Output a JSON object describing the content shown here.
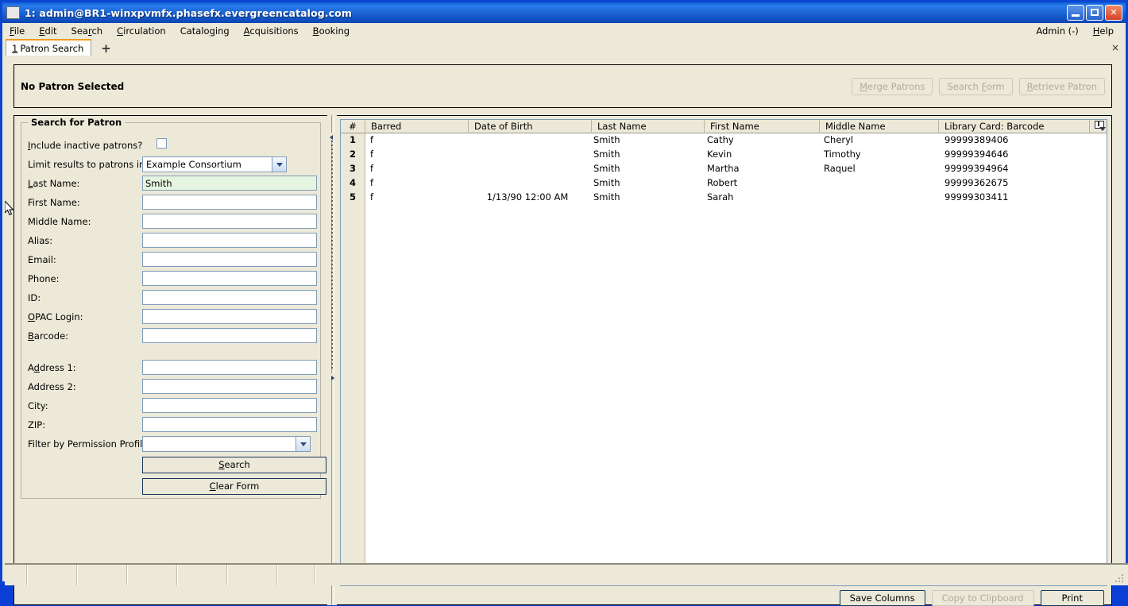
{
  "window": {
    "title": "1: admin@BR1-winxpvmfx.phasefx.evergreencatalog.com",
    "minimize_label": "Minimize",
    "maximize_label": "Maximize",
    "close_label": "Close"
  },
  "menubar": {
    "items": [
      {
        "label": "File",
        "accel": "F"
      },
      {
        "label": "Edit",
        "accel": "E"
      },
      {
        "label": "Search",
        "accel": "r"
      },
      {
        "label": "Circulation",
        "accel": "C"
      },
      {
        "label": "Cataloging",
        "accel": "g"
      },
      {
        "label": "Acquisitions",
        "accel": "A"
      },
      {
        "label": "Booking",
        "accel": "B"
      }
    ],
    "right": [
      {
        "label": "Admin (-)",
        "accel": ""
      },
      {
        "label": "Help",
        "accel": "H"
      }
    ]
  },
  "tabs": {
    "active": {
      "number": "1",
      "label": "Patron Search"
    },
    "add_label": "+",
    "close_label": "×"
  },
  "patron_band": {
    "title": "No Patron Selected",
    "buttons": [
      {
        "label": "Merge Patrons",
        "disabled": true
      },
      {
        "label": "Search Form",
        "disabled": true
      },
      {
        "label": "Retrieve Patron",
        "disabled": true
      }
    ]
  },
  "search_form": {
    "legend": "Search for Patron",
    "fields": [
      {
        "name": "include-inactive",
        "label": "Include inactive patrons?",
        "type": "checkbox",
        "value": "",
        "checked": false
      },
      {
        "name": "limit-results-org",
        "label": "Limit results to patrons in",
        "type": "select",
        "value": "Example Consortium"
      },
      {
        "name": "last-name",
        "label": "Last Name:",
        "type": "text",
        "value": "Smith",
        "focused": true
      },
      {
        "name": "first-name",
        "label": "First Name:",
        "type": "text",
        "value": ""
      },
      {
        "name": "middle-name",
        "label": "Middle Name:",
        "type": "text",
        "value": ""
      },
      {
        "name": "alias",
        "label": "Alias:",
        "type": "text",
        "value": ""
      },
      {
        "name": "email",
        "label": "Email:",
        "type": "text",
        "value": ""
      },
      {
        "name": "phone",
        "label": "Phone:",
        "type": "text",
        "value": ""
      },
      {
        "name": "id",
        "label": "ID:",
        "type": "text",
        "value": ""
      },
      {
        "name": "opac-login",
        "label": "OPAC Login:",
        "type": "text",
        "value": ""
      },
      {
        "name": "barcode",
        "label": "Barcode:",
        "type": "text",
        "value": ""
      },
      {
        "name": "address-1",
        "label": "Address 1:",
        "type": "text",
        "value": ""
      },
      {
        "name": "address-2",
        "label": "Address 2:",
        "type": "text",
        "value": ""
      },
      {
        "name": "city",
        "label": "City:",
        "type": "text",
        "value": ""
      },
      {
        "name": "zip",
        "label": "ZIP:",
        "type": "text",
        "value": ""
      },
      {
        "name": "permission-profile",
        "label": "Filter by Permission Profile:",
        "type": "select",
        "value": ""
      }
    ],
    "search_button": "Search",
    "clear_button": "Clear Form"
  },
  "results": {
    "columns": [
      {
        "key": "num",
        "label": "#"
      },
      {
        "key": "barred",
        "label": "Barred"
      },
      {
        "key": "dob",
        "label": "Date of Birth"
      },
      {
        "key": "last",
        "label": "Last Name"
      },
      {
        "key": "first",
        "label": "First Name"
      },
      {
        "key": "middle",
        "label": "Middle Name"
      },
      {
        "key": "barcode",
        "label": "Library Card: Barcode"
      }
    ],
    "rows": [
      {
        "num": "1",
        "barred": "f",
        "dob": "",
        "last": "Smith",
        "first": "Cathy",
        "middle": "Cheryl",
        "barcode": "99999389406"
      },
      {
        "num": "2",
        "barred": "f",
        "dob": "",
        "last": "Smith",
        "first": "Kevin",
        "middle": "Timothy",
        "barcode": "99999394646"
      },
      {
        "num": "3",
        "barred": "f",
        "dob": "",
        "last": "Smith",
        "first": "Martha",
        "middle": "Raquel",
        "barcode": "99999394964"
      },
      {
        "num": "4",
        "barred": "f",
        "dob": "",
        "last": "Smith",
        "first": "Robert",
        "middle": "",
        "barcode": "99999362675"
      },
      {
        "num": "5",
        "barred": "f",
        "dob": "1/13/90 12:00 AM",
        "last": "Smith",
        "first": "Sarah",
        "middle": "",
        "barcode": "99999303411"
      }
    ],
    "buttons": [
      {
        "label": "Save Columns",
        "disabled": false
      },
      {
        "label": "Copy to Clipboard",
        "disabled": true
      },
      {
        "label": "Print",
        "disabled": false
      }
    ]
  },
  "colors": {
    "titlebar_blue": "#1458c8",
    "window_border": "#0a46d2",
    "face": "#ece9d8",
    "field_border": "#7f9db9",
    "focused_field_bg": "#e6f5e0",
    "tab_accent": "#f09a21",
    "disabled_text": "#b0aa9c"
  }
}
